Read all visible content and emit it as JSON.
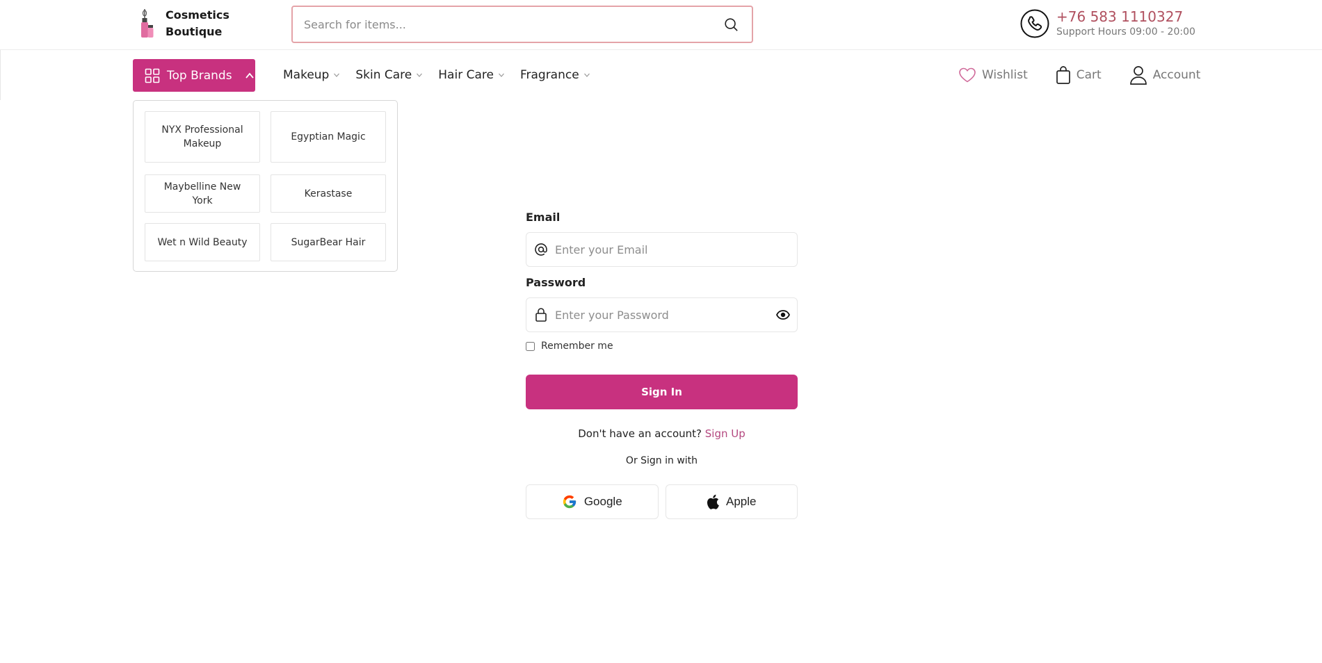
{
  "header": {
    "logo_line1": "Cosmetics",
    "logo_line2": "Boutique",
    "search_placeholder": "Search for items...",
    "phone": "+76 583 1110327",
    "support_hours": "Support Hours 09:00 - 20:00"
  },
  "nav": {
    "brands_label": "Top Brands",
    "items": [
      {
        "label": "Makeup"
      },
      {
        "label": "Skin Care"
      },
      {
        "label": "Hair Care"
      },
      {
        "label": "Fragrance"
      }
    ],
    "wishlist": "Wishlist",
    "cart": "Cart",
    "account": "Account"
  },
  "brands": [
    "NYX Professional Makeup",
    "Egyptian Magic",
    "Maybelline New York",
    "Kerastase",
    "Wet n Wild Beauty",
    "SugarBear Hair"
  ],
  "form": {
    "email_label": "Email",
    "email_placeholder": "Enter your Email",
    "password_label": "Password",
    "password_placeholder": "Enter your Password",
    "remember_label": "Remember me",
    "signin_label": "Sign In",
    "no_account_text": "Don't have an account?",
    "signup_link": "Sign Up",
    "or_text": "Or Sign in with",
    "google_label": "Google",
    "apple_label": "Apple"
  },
  "colors": {
    "accent": "#c8317f",
    "phone": "#b0505f",
    "search_border": "#e4a3a8"
  },
  "icons": {
    "logo": "cosmetics-logo-icon",
    "search": "search-icon",
    "phone": "phone-icon",
    "brands": "grid-icon",
    "wishlist": "heart-icon",
    "cart": "shopping-bag-icon",
    "account": "user-icon",
    "email": "at-sign-icon",
    "password": "lock-icon",
    "reveal": "eye-icon",
    "google": "google-icon",
    "apple": "apple-icon"
  }
}
